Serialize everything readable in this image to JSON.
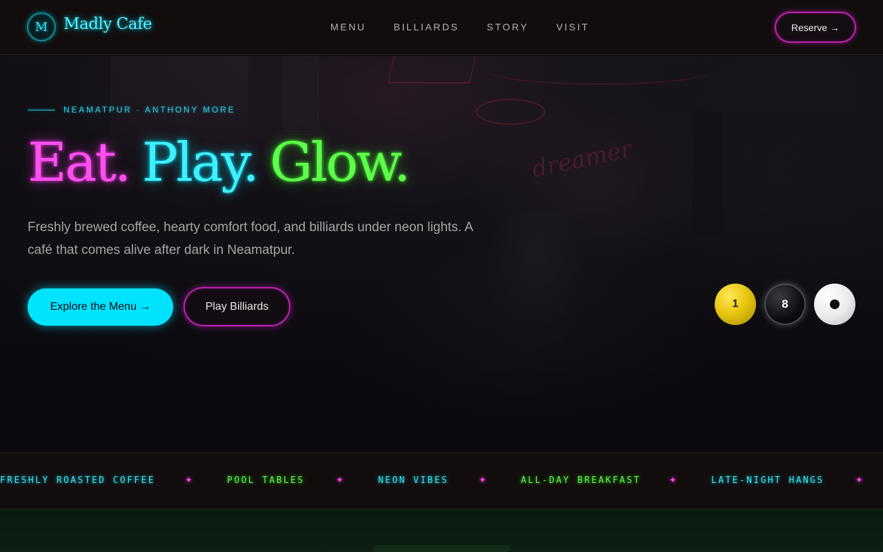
{
  "brand": {
    "badge": "M",
    "name": "Madly Cafe"
  },
  "nav": {
    "items": [
      {
        "label": "MENU"
      },
      {
        "label": "BILLIARDS"
      },
      {
        "label": "STORY"
      },
      {
        "label": "VISIT"
      }
    ],
    "reserve_label": "Reserve →"
  },
  "hero": {
    "eyebrow": "NEAMATPUR · ANTHONY MORE",
    "headline": {
      "word1": "Eat.",
      "word2": "Play.",
      "word3": "Glow."
    },
    "subtitle": "Freshly brewed coffee, hearty comfort food, and billiards under neon lights. A café that comes alive after dark in Neamatpur.",
    "primary_cta": "Explore the Menu →",
    "secondary_cta": "Play Billiards",
    "background_sign": "dreamer",
    "balls": [
      {
        "label": "1",
        "color": "#e8c50f"
      },
      {
        "label": "8",
        "color": "#0e0e12"
      },
      {
        "label": "",
        "color": "#ffffff"
      }
    ]
  },
  "marquee": {
    "items": [
      {
        "label": "FRESHLY ROASTED COFFEE",
        "color": "cyan"
      },
      {
        "label": "POOL TABLES",
        "color": "green"
      },
      {
        "label": "NEON VIBES",
        "color": "cyan"
      },
      {
        "label": "ALL-DAY BREAKFAST",
        "color": "green"
      },
      {
        "label": "LATE-NIGHT HANGS",
        "color": "cyan"
      }
    ],
    "separator": "✦"
  },
  "colors": {
    "neon_pink": "#ff4ff0",
    "neon_cyan": "#3ff0ff",
    "neon_green": "#5dff4a",
    "background": "#0b0a0e",
    "header_bg": "#120d0c"
  }
}
